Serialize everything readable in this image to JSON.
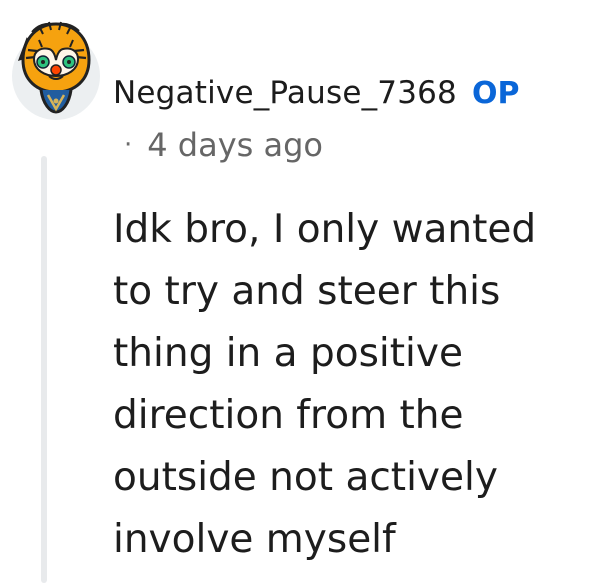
{
  "comment": {
    "author": "Negative_Pause_7368",
    "badge": "OP",
    "separator": "·",
    "timestamp": "4 days ago",
    "body": "Idk bro, I only wanted\nto try and steer this\nthing in a positive\ndirection from the\noutside not actively\ninvolve myself"
  },
  "avatar": {
    "icon": "reddit-snoo-tiger-avatar-icon"
  },
  "colors": {
    "op_badge": "#0a66d8",
    "meta_text": "#6a6a6a",
    "thread_line": "#e8eaec"
  }
}
